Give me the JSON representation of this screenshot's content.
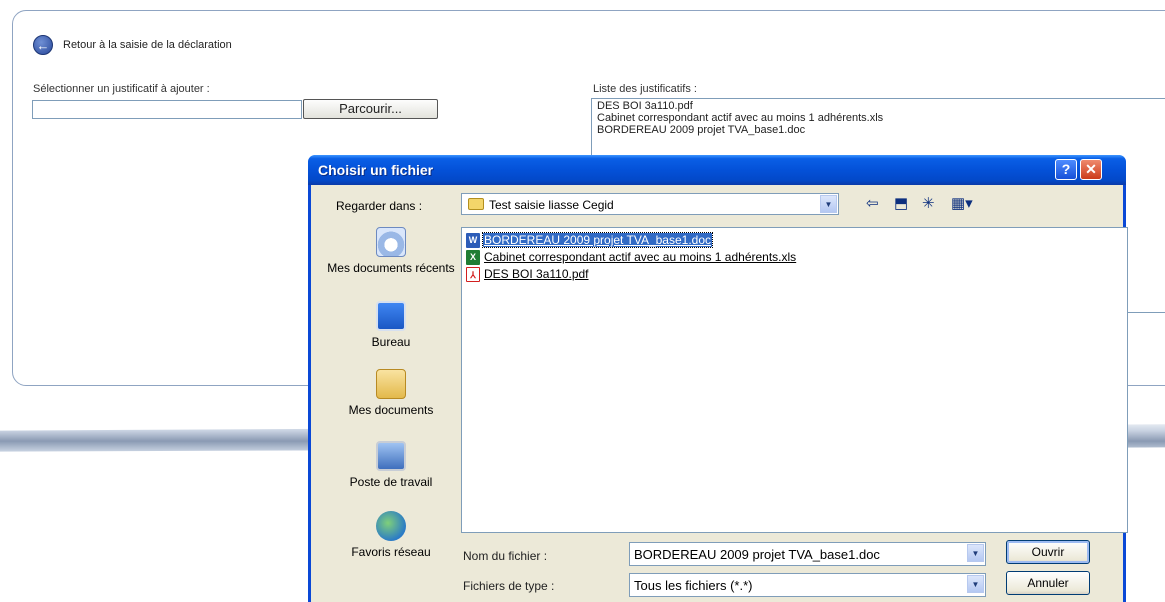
{
  "page": {
    "back_link": "Retour à la saisie de la déclaration",
    "select_label": "Sélectionner un justificatif à ajouter :",
    "file_input_value": "",
    "browse_label": "Parcourir...",
    "list_label": "Liste des justificatifs :",
    "justificatifs": [
      "DES BOI 3a110.pdf",
      "Cabinet correspondant actif avec au moins 1 adhérents.xls",
      "BORDEREAU 2009 projet TVA_base1.doc"
    ]
  },
  "dialog": {
    "title": "Choisir un fichier",
    "help_glyph": "?",
    "close_glyph": "✕",
    "look_in_label": "Regarder dans :",
    "look_in_value": "Test saisie liasse Cegid",
    "toolbar_icons": [
      "back-arrow-icon",
      "up-folder-icon",
      "new-folder-icon",
      "view-menu-icon"
    ],
    "places": [
      {
        "label": "Mes documents récents",
        "icon": "recent-documents-icon"
      },
      {
        "label": "Bureau",
        "icon": "desktop-icon"
      },
      {
        "label": "Mes documents",
        "icon": "my-documents-icon"
      },
      {
        "label": "Poste de travail",
        "icon": "my-computer-icon"
      },
      {
        "label": "Favoris réseau",
        "icon": "network-places-icon"
      }
    ],
    "files": [
      {
        "name": "BORDEREAU 2009 projet TVA_base1.doc",
        "icon": "word-doc-icon",
        "icon_glyph": "W",
        "selected": true
      },
      {
        "name": "Cabinet correspondant actif avec au moins 1 adhérents.xls",
        "icon": "excel-xls-icon",
        "icon_glyph": "X",
        "selected": false
      },
      {
        "name": "DES BOI 3a110.pdf",
        "icon": "pdf-icon",
        "icon_glyph": "⅄",
        "selected": false
      }
    ],
    "filename_label": "Nom du fichier :",
    "filename_value": "BORDEREAU 2009 projet TVA_base1.doc",
    "filetype_label": "Fichiers de type :",
    "filetype_value": "Tous les fichiers (*.*)",
    "open_label": "Ouvrir",
    "cancel_label": "Annuler",
    "accent_color": "#0a48d6",
    "selection_color": "#316ac5"
  }
}
